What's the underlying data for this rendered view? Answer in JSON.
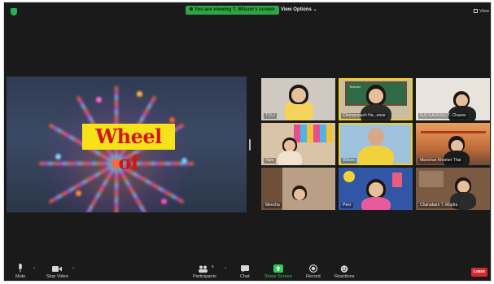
{
  "topbar": {
    "share_banner": "You are viewing T. Wilson's screen",
    "view_options": "View Options ⌄",
    "view_button": "View"
  },
  "shared_screen": {
    "slide_title": "Wheel of"
  },
  "gallery": {
    "tiles": [
      {
        "name": "T.O.J"
      },
      {
        "name": "Chompunuch Ha...ense"
      },
      {
        "name": "G.D.V.A.R.N.U.T. Chavez"
      },
      {
        "name": "Hare"
      },
      {
        "name": "Wilson"
      },
      {
        "name": "Marichan Khomer Thai"
      },
      {
        "name": "Meecha"
      },
      {
        "name": "Peer"
      },
      {
        "name": "Chanakarn T. Mojdra"
      }
    ]
  },
  "toolbar": {
    "mute": "Mute",
    "stop_video": "Stop Video",
    "participants": "Participants",
    "participants_count": "9",
    "chat": "Chat",
    "share_screen": "Share Screen",
    "record": "Record",
    "reactions": "Reactions",
    "leave": "Leave"
  },
  "colors": {
    "share_green": "#2ea444",
    "leave_red": "#d8282f",
    "active_speaker": "#f0d01a"
  }
}
